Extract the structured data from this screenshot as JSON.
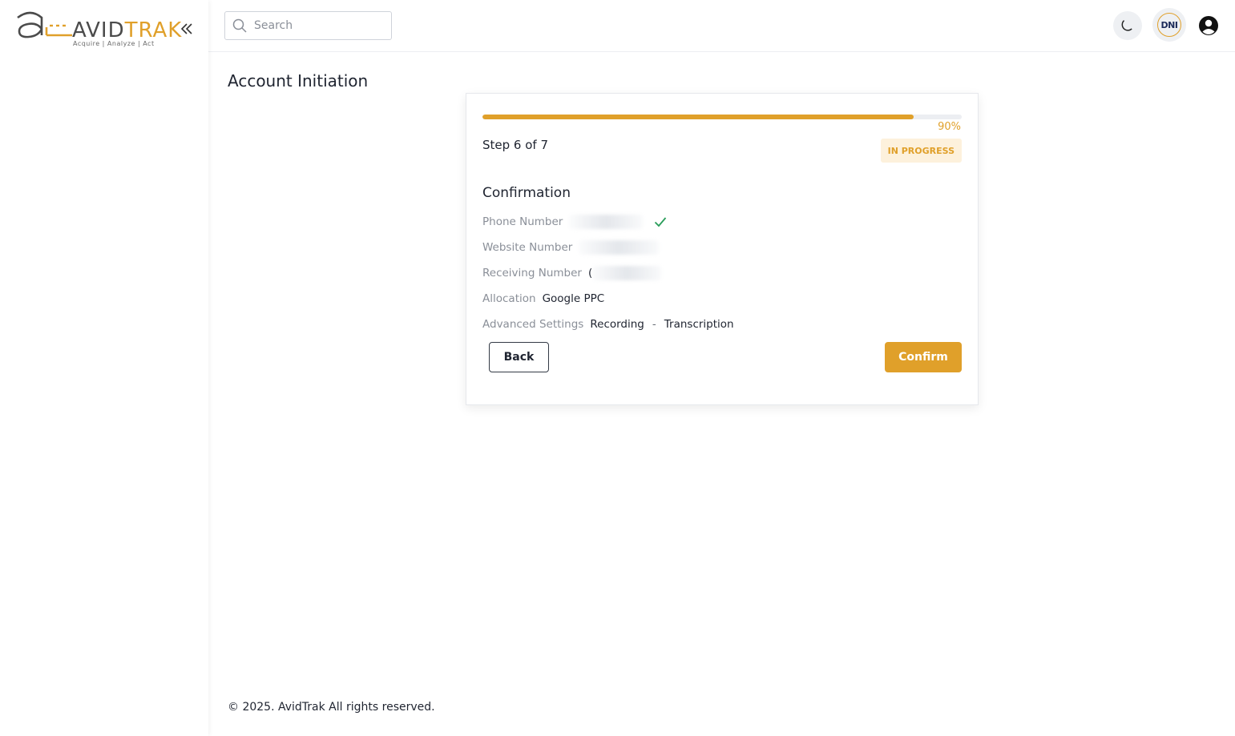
{
  "brand": {
    "name_part1": "AVID",
    "name_part2": "TRAK",
    "tagline": "Acquire  |  Analyze  |  Act",
    "accent_color": "#e0a02a"
  },
  "header": {
    "search": {
      "placeholder": "Search",
      "value": ""
    },
    "theme_icon": "moon-icon",
    "dni_label": "DNI",
    "user_icon": "user-circle-icon"
  },
  "page": {
    "title": "Account Initiation"
  },
  "wizard": {
    "progress_percent": 90,
    "progress_label": "90%",
    "step_label": "Step 6 of 7",
    "status": "IN PROGRESS",
    "section_title": "Confirmation",
    "fields": {
      "phone_number": {
        "label": "Phone Number",
        "value": ""
      },
      "website_number": {
        "label": "Website Number",
        "value": ""
      },
      "receiving_number": {
        "label": "Receiving Number",
        "value": "("
      },
      "allocation": {
        "label": "Allocation",
        "value": "Google PPC"
      },
      "advanced_settings": {
        "label": "Advanced Settings",
        "items": [
          "Recording",
          "Transcription"
        ],
        "separator": "-"
      }
    },
    "back_label": "Back",
    "confirm_label": "Confirm"
  },
  "footer": {
    "text": "© 2025. AvidTrak All rights reserved."
  }
}
